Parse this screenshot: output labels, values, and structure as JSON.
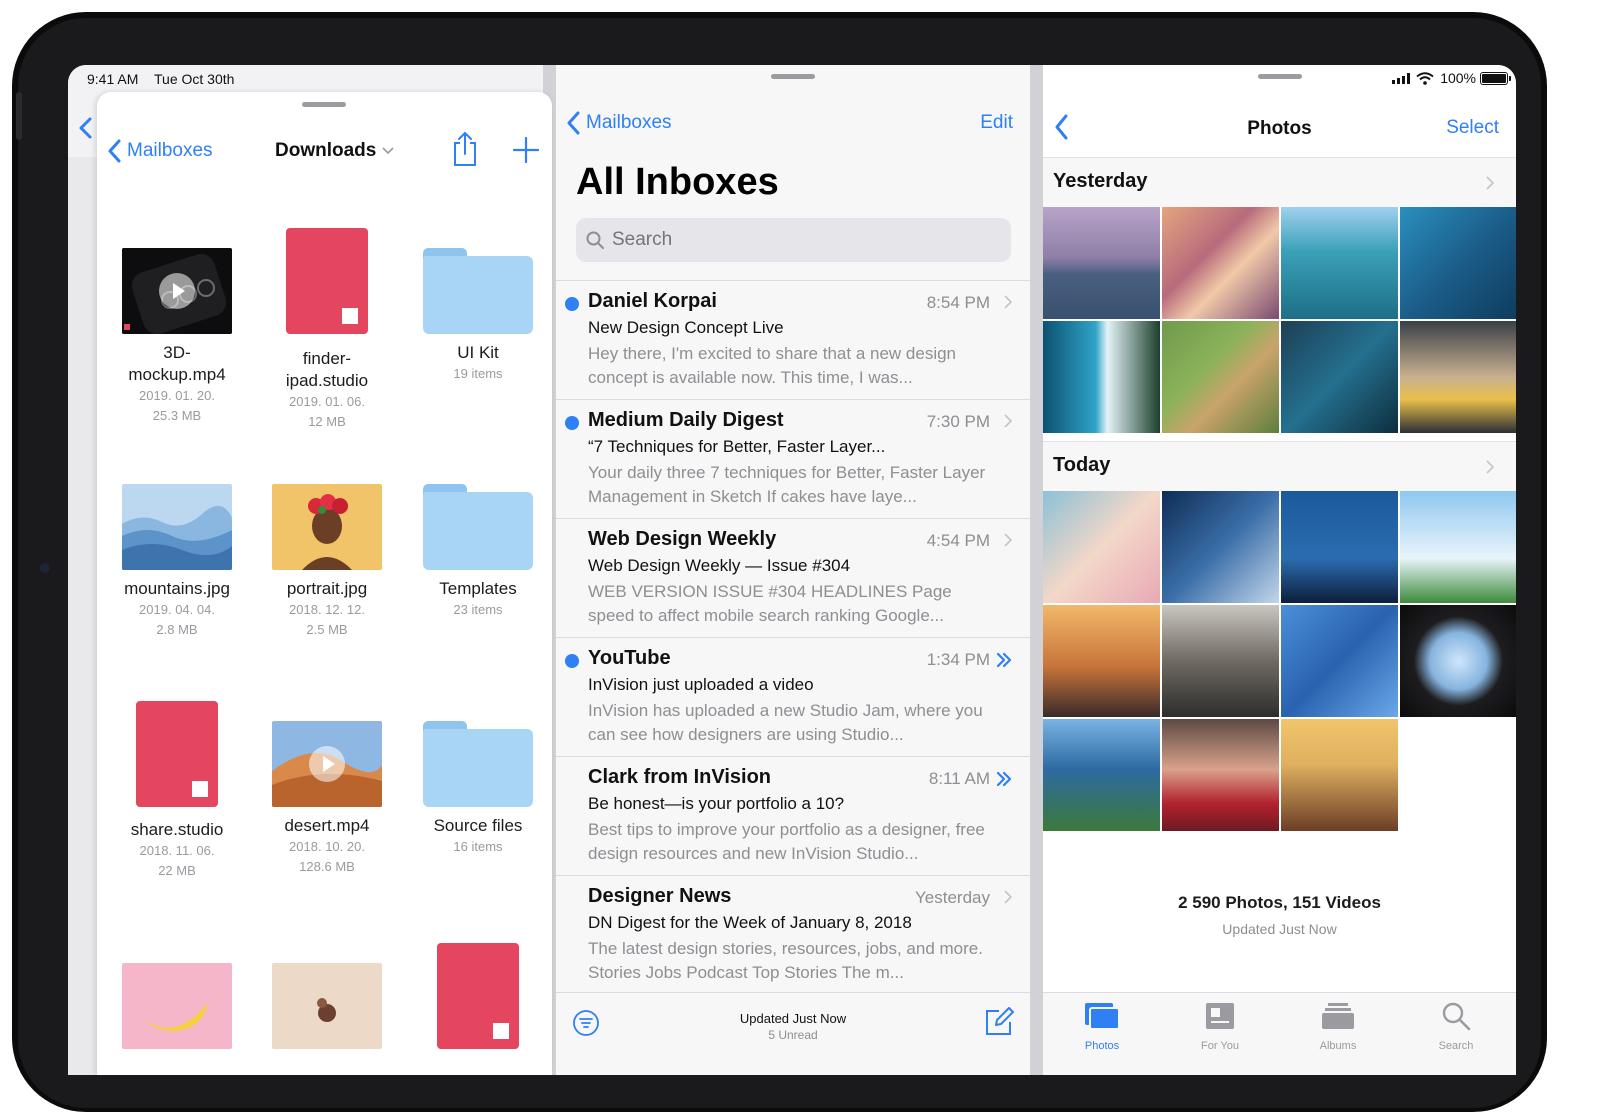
{
  "status_bar": {
    "time": "9:41 AM",
    "date": "Tue Oct 30th",
    "battery": "100%"
  },
  "files": {
    "back_label": "Mailboxes",
    "title": "Downloads",
    "items": [
      {
        "name_line1": "3D-",
        "name_line2": "mockup.mp4",
        "date": "2019. 01. 20.",
        "size": "25.3 MB",
        "kind": "video"
      },
      {
        "name_line1": "finder-",
        "name_line2": "ipad.studio",
        "date": "2019. 01. 06.",
        "size": "12 MB",
        "kind": "studio"
      },
      {
        "name_line1": "UI Kit",
        "name_line2": "",
        "date": "19 items",
        "size": "",
        "kind": "folder"
      },
      {
        "name_line1": "mountains.jpg",
        "name_line2": "",
        "date": "2019. 04. 04.",
        "size": "2.8 MB",
        "kind": "image"
      },
      {
        "name_line1": "portrait.jpg",
        "name_line2": "",
        "date": "2018. 12. 12.",
        "size": "2.5 MB",
        "kind": "image"
      },
      {
        "name_line1": "Templates",
        "name_line2": "",
        "date": "23 items",
        "size": "",
        "kind": "folder"
      },
      {
        "name_line1": "share.studio",
        "name_line2": "",
        "date": "2018. 11. 06.",
        "size": "22 MB",
        "kind": "studio"
      },
      {
        "name_line1": "desert.mp4",
        "name_line2": "",
        "date": "2018. 10. 20.",
        "size": "128.6 MB",
        "kind": "video"
      },
      {
        "name_line1": "Source files",
        "name_line2": "",
        "date": "16 items",
        "size": "",
        "kind": "folder"
      }
    ]
  },
  "mail": {
    "back_label": "Mailboxes",
    "edit_label": "Edit",
    "title": "All Inboxes",
    "search_placeholder": "Search",
    "messages": [
      {
        "sender": "Daniel Korpai",
        "time": "8:54 PM",
        "subject": "New Design Concept Live",
        "preview": "Hey there, I'm excited to share that a new design concept is available now. This time, I was...",
        "unread": true,
        "vip": false
      },
      {
        "sender": "Medium Daily Digest",
        "time": "7:30 PM",
        "subject": "“7 Techniques for Better, Faster Layer...",
        "preview": "Your daily three 7 techniques for Better, Faster Layer Management in Sketch If cakes have laye...",
        "unread": true,
        "vip": false
      },
      {
        "sender": "Web Design Weekly",
        "time": "4:54 PM",
        "subject": "Web Design Weekly — Issue #304",
        "preview": "WEB VERSION ISSUE #304 HEADLINES Page speed to affect mobile search ranking Google...",
        "unread": false,
        "vip": false
      },
      {
        "sender": "YouTube",
        "time": "1:34 PM",
        "subject": "InVision just uploaded a video",
        "preview": "InVision has uploaded a new Studio Jam, where you can see how designers are using Studio...",
        "unread": true,
        "vip": true
      },
      {
        "sender": "Clark from InVision",
        "time": "8:11 AM",
        "subject": "Be honest—is your portfolio a 10?",
        "preview": "Best tips to improve your portfolio as a designer, free design resources and new InVision Studio...",
        "unread": false,
        "vip": true
      },
      {
        "sender": "Designer News",
        "time": "Yesterday",
        "subject": "DN Digest for the Week of January 8, 2018",
        "preview": "The latest design stories, resources, jobs, and more. Stories Jobs Podcast Top Stories The m...",
        "unread": false,
        "vip": false
      }
    ],
    "footer_updated": "Updated Just Now",
    "footer_unread": "5 Unread"
  },
  "photos": {
    "title": "Photos",
    "select_label": "Select",
    "section_yesterday": "Yesterday",
    "section_today": "Today",
    "counts": "2 590 Photos, 151 Videos",
    "updated": "Updated Just Now",
    "tabs": [
      "Photos",
      "For You",
      "Albums",
      "Search"
    ]
  },
  "colors": {
    "accent": "#2f7ff5",
    "studio_red": "#e5465f",
    "folder_blue": "#a8d4f6"
  }
}
